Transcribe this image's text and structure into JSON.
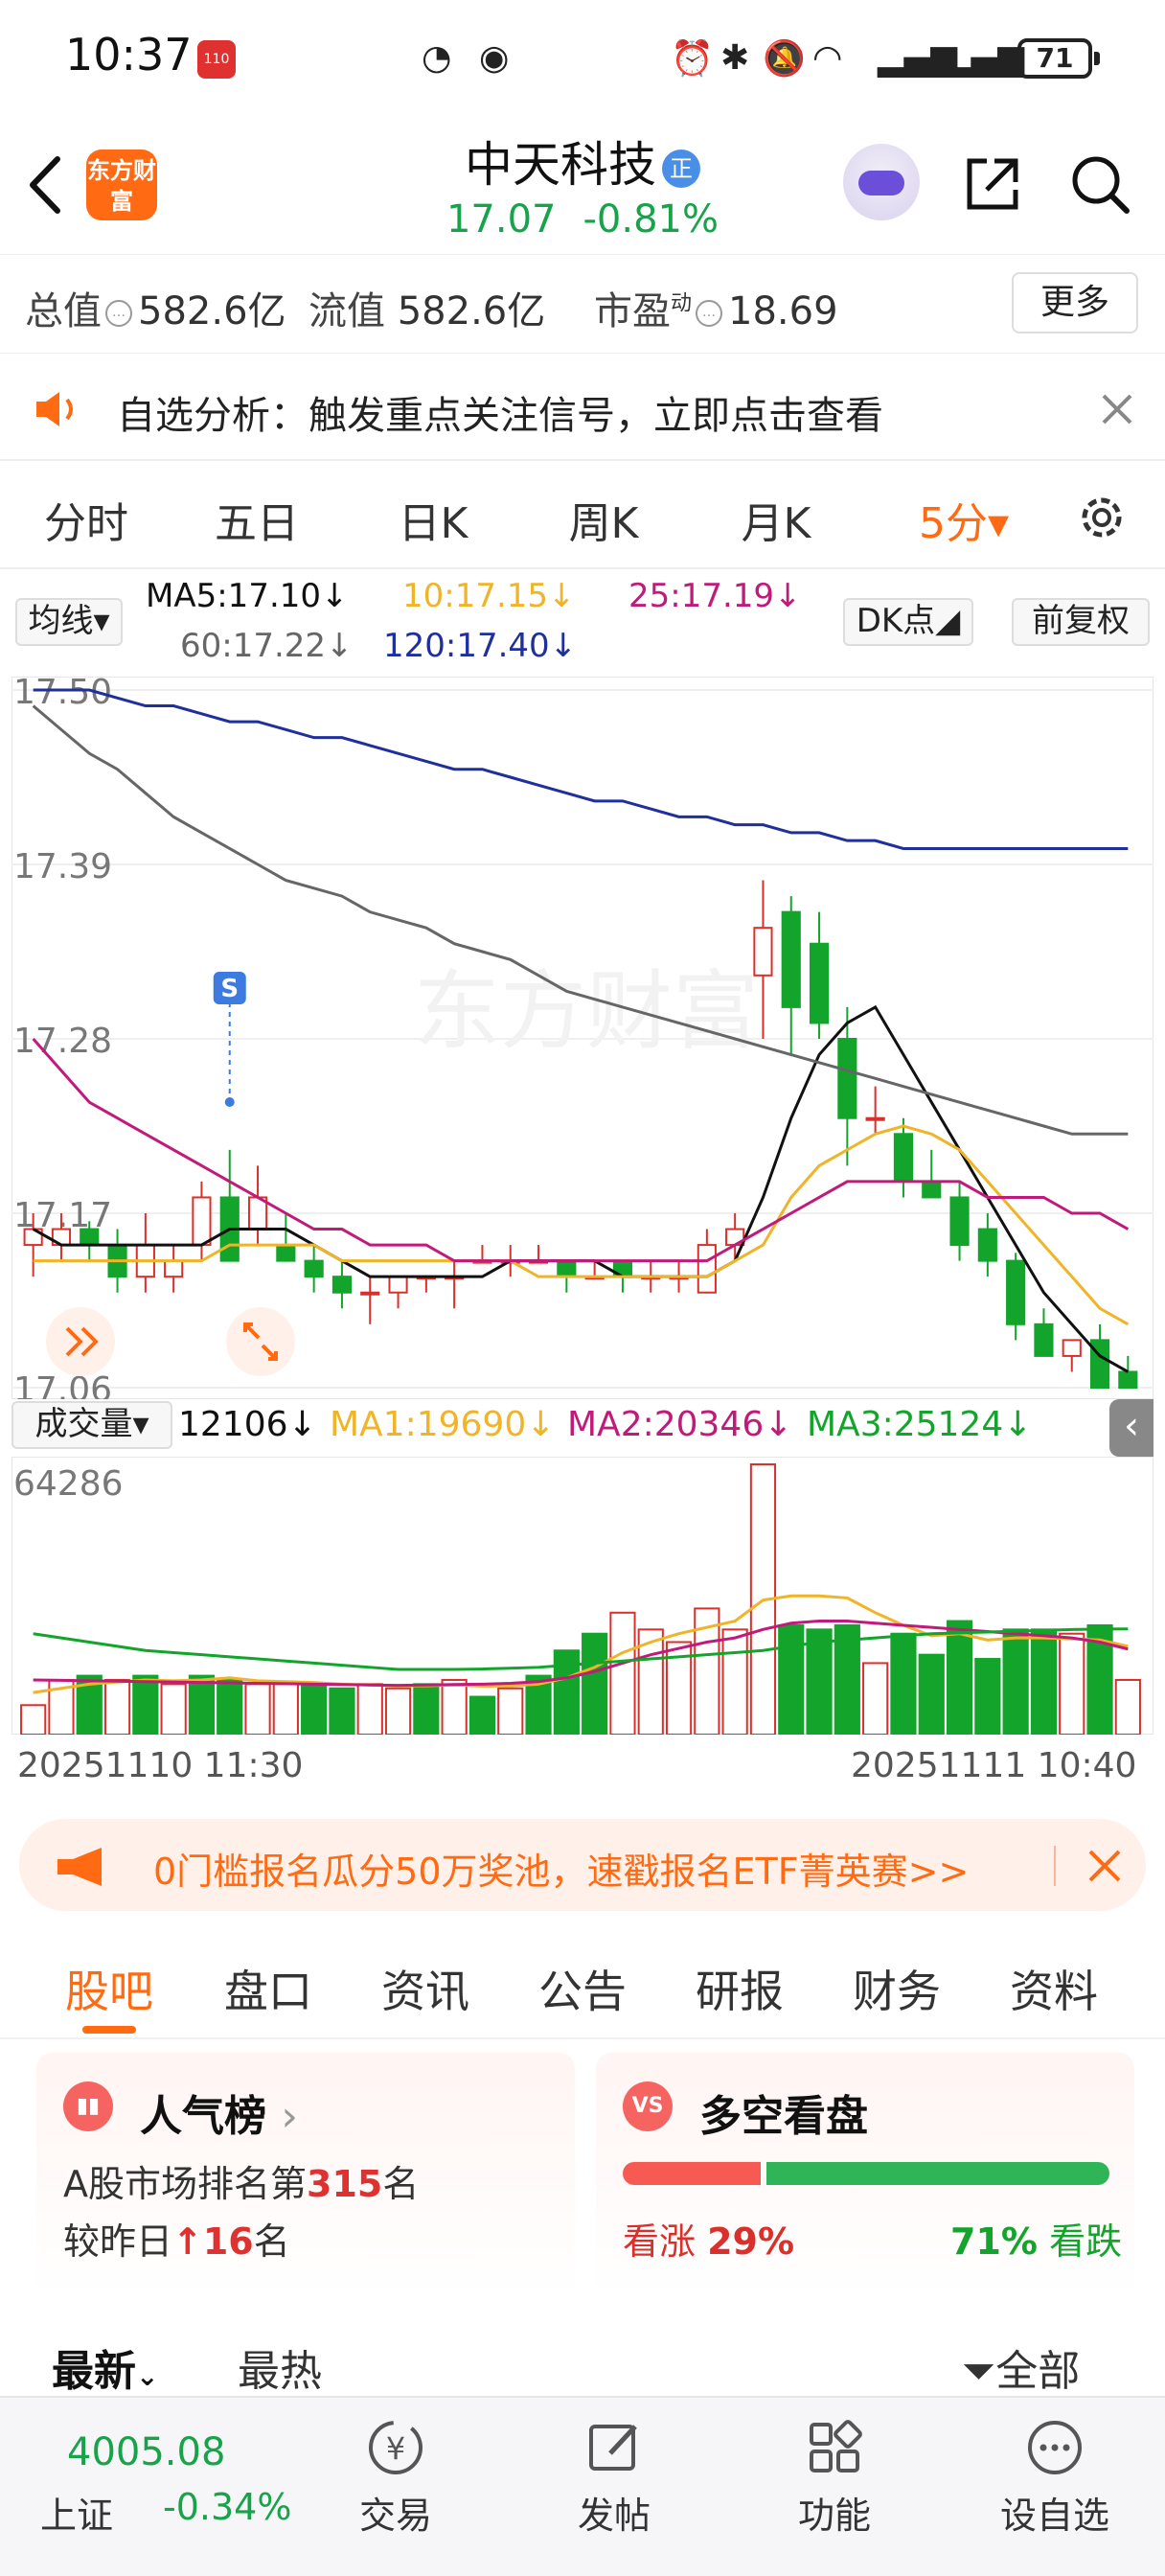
{
  "status_bar": {
    "time": "10:37",
    "battery": "71",
    "app_badge": "110"
  },
  "header": {
    "stock_name": "中天科技",
    "badge": "正",
    "price": "17.07",
    "change_pct": "-0.81%",
    "logo_text": "东方财富"
  },
  "value_bar": {
    "total_label": "总值",
    "total_value": "582.6亿",
    "float_label": "流值",
    "float_value": "582.6亿",
    "pe_label": "市盈",
    "pe_sup": "动",
    "pe_value": "18.69",
    "more_label": "更多"
  },
  "notice": {
    "text": "自选分析：触发重点关注信号，立即点击查看"
  },
  "chart_tabs": [
    {
      "label": "分时"
    },
    {
      "label": "五日"
    },
    {
      "label": "日K"
    },
    {
      "label": "周K"
    },
    {
      "label": "月K"
    },
    {
      "label": "5分▾"
    }
  ],
  "ma_legend": {
    "selector": "均线▾",
    "ma5": "MA5:17.10↓",
    "ma10": "10:17.15↓",
    "ma25": "25:17.19↓",
    "ma60": "60:17.22↓",
    "ma120": "120:17.40↓",
    "dk": "DK点◢",
    "adjust": "前复权"
  },
  "colors": {
    "up": "#d9302b",
    "down": "#13a52b",
    "ma5": "#111111",
    "ma10": "#f0b429",
    "ma25": "#c01a7a",
    "ma60": "#666666",
    "ma120": "#1f2f9c",
    "accent": "#ff6a13"
  },
  "chart_data": [
    {
      "type": "candlestick",
      "title": "",
      "y_ticks": [
        "17.50",
        "17.39",
        "17.28",
        "17.17",
        "17.06"
      ],
      "ylim": [
        17.06,
        17.5
      ],
      "s_marker": "S",
      "watermark": "东方财富",
      "candles": [
        {
          "o": 17.15,
          "h": 17.17,
          "l": 17.13,
          "c": 17.16
        },
        {
          "o": 17.15,
          "h": 17.17,
          "l": 17.14,
          "c": 17.16
        },
        {
          "o": 17.16,
          "h": 17.165,
          "l": 17.14,
          "c": 17.15
        },
        {
          "o": 17.15,
          "h": 17.16,
          "l": 17.12,
          "c": 17.13
        },
        {
          "o": 17.13,
          "h": 17.17,
          "l": 17.12,
          "c": 17.15
        },
        {
          "o": 17.13,
          "h": 17.15,
          "l": 17.12,
          "c": 17.14
        },
        {
          "o": 17.15,
          "h": 17.19,
          "l": 17.14,
          "c": 17.18
        },
        {
          "o": 17.18,
          "h": 17.21,
          "l": 17.16,
          "c": 17.14
        },
        {
          "o": 17.16,
          "h": 17.2,
          "l": 17.15,
          "c": 17.18
        },
        {
          "o": 17.15,
          "h": 17.17,
          "l": 17.14,
          "c": 17.14
        },
        {
          "o": 17.14,
          "h": 17.15,
          "l": 17.12,
          "c": 17.13
        },
        {
          "o": 17.13,
          "h": 17.14,
          "l": 17.11,
          "c": 17.12
        },
        {
          "o": 17.12,
          "h": 17.13,
          "l": 17.1,
          "c": 17.12
        },
        {
          "o": 17.12,
          "h": 17.13,
          "l": 17.11,
          "c": 17.13
        },
        {
          "o": 17.13,
          "h": 17.13,
          "l": 17.12,
          "c": 17.13
        },
        {
          "o": 17.13,
          "h": 17.14,
          "l": 17.11,
          "c": 17.13
        },
        {
          "o": 17.14,
          "h": 17.15,
          "l": 17.14,
          "c": 17.14
        },
        {
          "o": 17.14,
          "h": 17.15,
          "l": 17.13,
          "c": 17.14
        },
        {
          "o": 17.14,
          "h": 17.15,
          "l": 17.14,
          "c": 17.14
        },
        {
          "o": 17.14,
          "h": 17.14,
          "l": 17.12,
          "c": 17.13
        },
        {
          "o": 17.13,
          "h": 17.14,
          "l": 17.13,
          "c": 17.13
        },
        {
          "o": 17.14,
          "h": 17.14,
          "l": 17.12,
          "c": 17.13
        },
        {
          "o": 17.13,
          "h": 17.14,
          "l": 17.12,
          "c": 17.13
        },
        {
          "o": 17.13,
          "h": 17.14,
          "l": 17.12,
          "c": 17.13
        },
        {
          "o": 17.12,
          "h": 17.16,
          "l": 17.12,
          "c": 17.15
        },
        {
          "o": 17.15,
          "h": 17.17,
          "l": 17.14,
          "c": 17.16
        },
        {
          "o": 17.32,
          "h": 17.38,
          "l": 17.28,
          "c": 17.35
        },
        {
          "o": 17.36,
          "h": 17.37,
          "l": 17.27,
          "c": 17.3
        },
        {
          "o": 17.34,
          "h": 17.36,
          "l": 17.28,
          "c": 17.29
        },
        {
          "o": 17.28,
          "h": 17.3,
          "l": 17.2,
          "c": 17.23
        },
        {
          "o": 17.23,
          "h": 17.25,
          "l": 17.22,
          "c": 17.23
        },
        {
          "o": 17.22,
          "h": 17.23,
          "l": 17.18,
          "c": 17.19
        },
        {
          "o": 17.19,
          "h": 17.21,
          "l": 17.18,
          "c": 17.18
        },
        {
          "o": 17.18,
          "h": 17.19,
          "l": 17.14,
          "c": 17.15
        },
        {
          "o": 17.16,
          "h": 17.17,
          "l": 17.13,
          "c": 17.14
        },
        {
          "o": 17.14,
          "h": 17.145,
          "l": 17.09,
          "c": 17.1
        },
        {
          "o": 17.1,
          "h": 17.11,
          "l": 17.08,
          "c": 17.08
        },
        {
          "o": 17.08,
          "h": 17.09,
          "l": 17.07,
          "c": 17.09
        },
        {
          "o": 17.09,
          "h": 17.1,
          "l": 17.06,
          "c": 17.06
        },
        {
          "o": 17.07,
          "h": 17.08,
          "l": 17.06,
          "c": 17.06
        }
      ],
      "series": [
        {
          "color": "#111111",
          "values": [
            17.16,
            17.15,
            17.15,
            17.15,
            17.15,
            17.15,
            17.15,
            17.16,
            17.16,
            17.16,
            17.15,
            17.14,
            17.13,
            17.13,
            17.13,
            17.13,
            17.13,
            17.14,
            17.14,
            17.14,
            17.14,
            17.13,
            17.13,
            17.13,
            17.13,
            17.14,
            17.18,
            17.23,
            17.27,
            17.29,
            17.3,
            17.27,
            17.24,
            17.21,
            17.18,
            17.15,
            17.12,
            17.1,
            17.08,
            17.07
          ]
        },
        {
          "color": "#f0b429",
          "values": [
            17.14,
            17.14,
            17.14,
            17.14,
            17.14,
            17.14,
            17.14,
            17.15,
            17.15,
            17.15,
            17.15,
            17.14,
            17.14,
            17.14,
            17.14,
            17.14,
            17.14,
            17.14,
            17.13,
            17.13,
            17.13,
            17.13,
            17.13,
            17.13,
            17.13,
            17.14,
            17.15,
            17.18,
            17.2,
            17.21,
            17.22,
            17.225,
            17.22,
            17.21,
            17.19,
            17.17,
            17.15,
            17.13,
            17.11,
            17.1
          ]
        },
        {
          "color": "#c01a7a",
          "values": [
            17.28,
            17.26,
            17.24,
            17.23,
            17.22,
            17.21,
            17.2,
            17.19,
            17.18,
            17.17,
            17.16,
            17.16,
            17.15,
            17.15,
            17.15,
            17.14,
            17.14,
            17.14,
            17.14,
            17.14,
            17.14,
            17.14,
            17.14,
            17.14,
            17.14,
            17.15,
            17.16,
            17.17,
            17.18,
            17.19,
            17.19,
            17.19,
            17.19,
            17.19,
            17.18,
            17.18,
            17.18,
            17.17,
            17.17,
            17.16
          ]
        },
        {
          "color": "#666666",
          "values": [
            17.49,
            17.475,
            17.46,
            17.45,
            17.435,
            17.42,
            17.41,
            17.4,
            17.39,
            17.38,
            17.375,
            17.37,
            17.36,
            17.355,
            17.35,
            17.34,
            17.335,
            17.33,
            17.32,
            17.31,
            17.305,
            17.3,
            17.295,
            17.29,
            17.285,
            17.28,
            17.275,
            17.27,
            17.265,
            17.26,
            17.255,
            17.25,
            17.245,
            17.24,
            17.235,
            17.23,
            17.225,
            17.22,
            17.22,
            17.22
          ]
        },
        {
          "color": "#1f2f9c",
          "values": [
            17.5,
            17.5,
            17.5,
            17.495,
            17.49,
            17.49,
            17.485,
            17.48,
            17.48,
            17.475,
            17.47,
            17.47,
            17.465,
            17.46,
            17.455,
            17.45,
            17.45,
            17.445,
            17.44,
            17.435,
            17.43,
            17.43,
            17.425,
            17.42,
            17.42,
            17.415,
            17.415,
            17.41,
            17.41,
            17.405,
            17.405,
            17.4,
            17.4,
            17.4,
            17.4,
            17.4,
            17.4,
            17.4,
            17.4,
            17.4
          ]
        }
      ]
    },
    {
      "type": "bar",
      "title": "",
      "max_label": "64286",
      "ylim": [
        0,
        64286
      ],
      "dates": [
        "20251110 11:30",
        "20251111 10:40"
      ],
      "volumes": [
        7000,
        13000,
        14000,
        13000,
        14000,
        12000,
        14000,
        13000,
        12000,
        12000,
        12000,
        11000,
        12000,
        11000,
        12000,
        13000,
        9000,
        11000,
        14000,
        20000,
        24000,
        29000,
        25000,
        22000,
        30000,
        25000,
        64286,
        26000,
        25000,
        26000,
        17000,
        24000,
        19000,
        27000,
        18000,
        25000,
        25000,
        24000,
        26000,
        13000
      ],
      "volume_colors": [
        "u",
        "u",
        "d",
        "u",
        "d",
        "u",
        "d",
        "d",
        "u",
        "u",
        "d",
        "d",
        "u",
        "u",
        "d",
        "u",
        "d",
        "u",
        "d",
        "d",
        "d",
        "u",
        "u",
        "u",
        "u",
        "u",
        "u",
        "d",
        "d",
        "d",
        "u",
        "d",
        "d",
        "d",
        "d",
        "d",
        "d",
        "u",
        "d",
        "u"
      ],
      "series": [
        {
          "name": "MA1",
          "color": "#f0b429",
          "values": [
            10000,
            11000,
            12000,
            12500,
            13000,
            12800,
            13000,
            13500,
            12800,
            12600,
            12400,
            12000,
            11800,
            11600,
            11600,
            11800,
            11500,
            11600,
            12000,
            13500,
            16000,
            19500,
            22000,
            24000,
            25500,
            27000,
            32000,
            33000,
            33000,
            32500,
            29000,
            26000,
            23500,
            24000,
            22500,
            23000,
            23000,
            22800,
            22500,
            21000
          ]
        },
        {
          "name": "MA2",
          "color": "#c01a7a",
          "values": [
            13000,
            12900,
            12800,
            12700,
            12600,
            12500,
            12400,
            12300,
            12200,
            12100,
            12000,
            11900,
            11800,
            11700,
            11800,
            11900,
            12000,
            12200,
            12600,
            13500,
            15000,
            17000,
            19000,
            20500,
            22000,
            23000,
            25000,
            26500,
            27000,
            27000,
            26500,
            26000,
            25500,
            25000,
            24500,
            24000,
            23500,
            23000,
            22000,
            20346
          ]
        },
        {
          "name": "MA3",
          "color": "#13a52b",
          "values": [
            24000,
            23000,
            22000,
            21000,
            20000,
            19500,
            19000,
            18500,
            18000,
            17500,
            17000,
            16500,
            16000,
            15500,
            15500,
            15500,
            15600,
            15800,
            16000,
            16500,
            17000,
            17500,
            18000,
            18500,
            19000,
            19500,
            20000,
            21000,
            22000,
            22500,
            23000,
            23500,
            24000,
            24200,
            24400,
            24600,
            24800,
            25000,
            25100,
            25124
          ]
        }
      ]
    }
  ],
  "volume_legend": {
    "selector": "成交量▾",
    "vol": "12106↓",
    "ma1": "MA1:19690↓",
    "ma2": "MA2:20346↓",
    "ma3": "MA3:25124↓"
  },
  "promo": {
    "text": "0门槛报名瓜分50万奖池，速戳报名ETF菁英赛>>"
  },
  "section_tabs": [
    {
      "label": "股吧"
    },
    {
      "label": "盘口"
    },
    {
      "label": "资讯"
    },
    {
      "label": "公告"
    },
    {
      "label": "研报"
    },
    {
      "label": "财务"
    },
    {
      "label": "资料"
    }
  ],
  "popularity": {
    "title": "人气榜",
    "arrow": "›",
    "line1_pre": "A股市场排名第",
    "rank": "315",
    "line1_post": "名",
    "line2_pre": "较昨日",
    "change": "16",
    "line2_post": "名"
  },
  "sentiment": {
    "title": "多空看盘",
    "icon": "VS",
    "up_label": "看涨",
    "up_pct": "29%",
    "down_pct": "71%",
    "down_label": "看跌",
    "up_fraction": 0.29
  },
  "feed_sort": {
    "latest": "最新",
    "hot": "最热",
    "filter": "全部"
  },
  "bottom_nav": {
    "index_value": "4005.08",
    "index_name": "上证",
    "index_pct": "-0.34%",
    "items": [
      {
        "label": "交易"
      },
      {
        "label": "发帖"
      },
      {
        "label": "功能"
      },
      {
        "label": "设自选"
      }
    ]
  }
}
